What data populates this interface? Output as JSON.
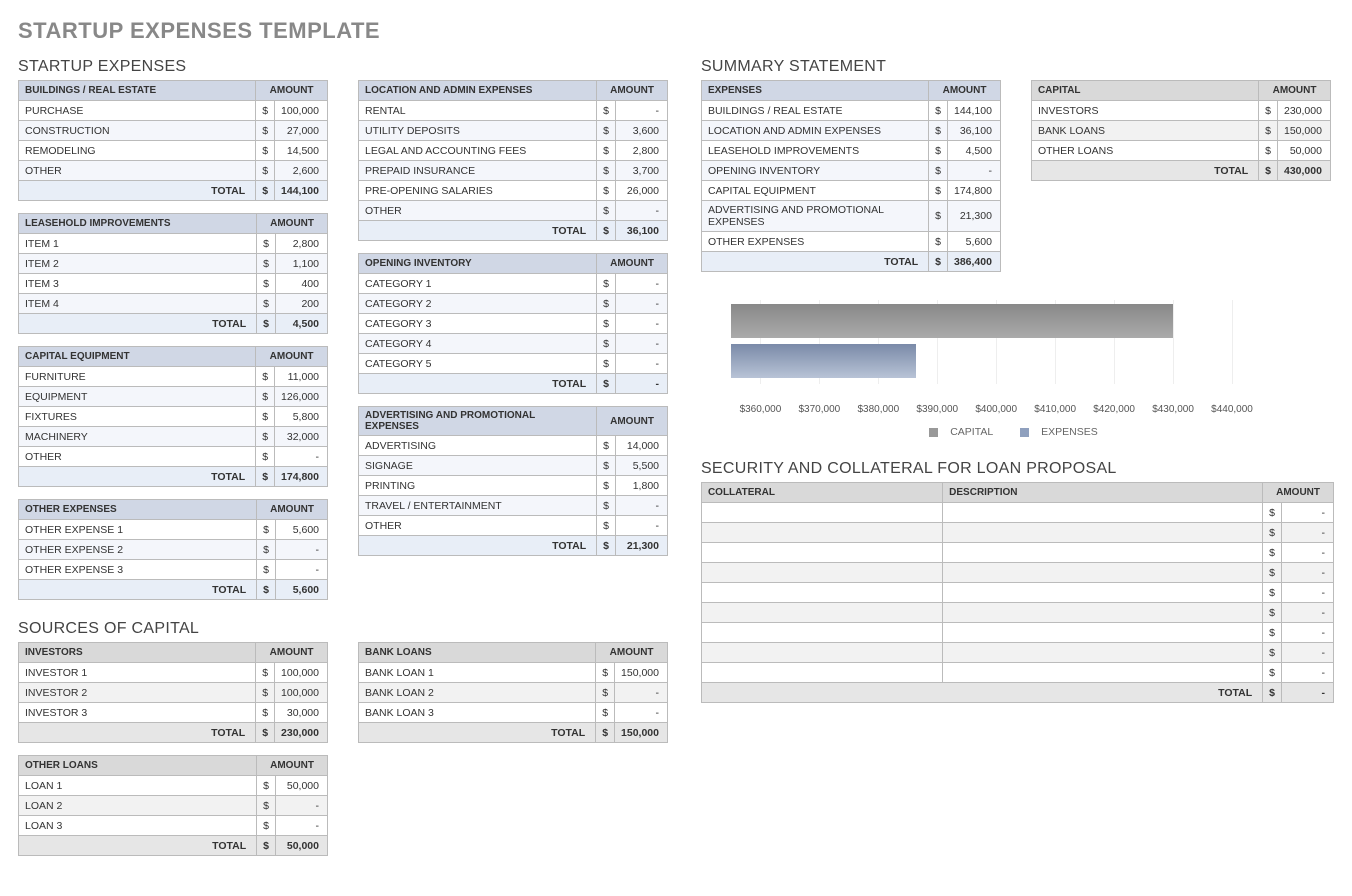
{
  "page_title": "STARTUP EXPENSES TEMPLATE",
  "sections": {
    "startup_expenses": "STARTUP EXPENSES",
    "sources_of_capital": "SOURCES OF CAPITAL",
    "summary_statement": "SUMMARY STATEMENT",
    "security_collateral": "SECURITY AND COLLATERAL FOR LOAN PROPOSAL"
  },
  "labels": {
    "amount": "AMOUNT",
    "total": "TOTAL",
    "description": "DESCRIPTION",
    "collateral": "COLLATERAL"
  },
  "tables": {
    "buildings": {
      "title": "BUILDINGS / REAL ESTATE",
      "rows": [
        {
          "label": "PURCHASE",
          "value": "100,000"
        },
        {
          "label": "CONSTRUCTION",
          "value": "27,000"
        },
        {
          "label": "REMODELING",
          "value": "14,500"
        },
        {
          "label": "OTHER",
          "value": "2,600"
        }
      ],
      "total": "144,100"
    },
    "leasehold": {
      "title": "LEASEHOLD IMPROVEMENTS",
      "rows": [
        {
          "label": "ITEM 1",
          "value": "2,800"
        },
        {
          "label": "ITEM 2",
          "value": "1,100"
        },
        {
          "label": "ITEM 3",
          "value": "400"
        },
        {
          "label": "ITEM 4",
          "value": "200"
        }
      ],
      "total": "4,500"
    },
    "capital_equipment": {
      "title": "CAPITAL EQUIPMENT",
      "rows": [
        {
          "label": "FURNITURE",
          "value": "11,000"
        },
        {
          "label": "EQUIPMENT",
          "value": "126,000"
        },
        {
          "label": "FIXTURES",
          "value": "5,800"
        },
        {
          "label": "MACHINERY",
          "value": "32,000"
        },
        {
          "label": "OTHER",
          "value": "-"
        }
      ],
      "total": "174,800"
    },
    "other_expenses": {
      "title": "OTHER EXPENSES",
      "rows": [
        {
          "label": "OTHER EXPENSE 1",
          "value": "5,600"
        },
        {
          "label": "OTHER EXPENSE 2",
          "value": "-"
        },
        {
          "label": "OTHER EXPENSE 3",
          "value": "-"
        }
      ],
      "total": "5,600"
    },
    "location_admin": {
      "title": "LOCATION AND ADMIN EXPENSES",
      "rows": [
        {
          "label": "RENTAL",
          "value": "-"
        },
        {
          "label": "UTILITY DEPOSITS",
          "value": "3,600"
        },
        {
          "label": "LEGAL AND ACCOUNTING FEES",
          "value": "2,800"
        },
        {
          "label": "PREPAID INSURANCE",
          "value": "3,700"
        },
        {
          "label": "PRE-OPENING SALARIES",
          "value": "26,000"
        },
        {
          "label": "OTHER",
          "value": "-"
        }
      ],
      "total": "36,100"
    },
    "opening_inventory": {
      "title": "OPENING INVENTORY",
      "rows": [
        {
          "label": "CATEGORY 1",
          "value": "-"
        },
        {
          "label": "CATEGORY 2",
          "value": "-"
        },
        {
          "label": "CATEGORY 3",
          "value": "-"
        },
        {
          "label": "CATEGORY 4",
          "value": "-"
        },
        {
          "label": "CATEGORY 5",
          "value": "-"
        }
      ],
      "total": "-"
    },
    "advertising": {
      "title": "ADVERTISING AND PROMOTIONAL EXPENSES",
      "rows": [
        {
          "label": "ADVERTISING",
          "value": "14,000"
        },
        {
          "label": "SIGNAGE",
          "value": "5,500"
        },
        {
          "label": "PRINTING",
          "value": "1,800"
        },
        {
          "label": "TRAVEL / ENTERTAINMENT",
          "value": "-"
        },
        {
          "label": "OTHER",
          "value": "-"
        }
      ],
      "total": "21,300"
    },
    "investors": {
      "title": "INVESTORS",
      "rows": [
        {
          "label": "INVESTOR 1",
          "value": "100,000"
        },
        {
          "label": "INVESTOR 2",
          "value": "100,000"
        },
        {
          "label": "INVESTOR 3",
          "value": "30,000"
        }
      ],
      "total": "230,000"
    },
    "other_loans": {
      "title": "OTHER LOANS",
      "rows": [
        {
          "label": "LOAN 1",
          "value": "50,000"
        },
        {
          "label": "LOAN 2",
          "value": "-"
        },
        {
          "label": "LOAN 3",
          "value": "-"
        }
      ],
      "total": "50,000"
    },
    "bank_loans": {
      "title": "BANK LOANS",
      "rows": [
        {
          "label": "BANK LOAN 1",
          "value": "150,000"
        },
        {
          "label": "BANK LOAN 2",
          "value": "-"
        },
        {
          "label": "BANK LOAN 3",
          "value": "-"
        }
      ],
      "total": "150,000"
    },
    "summary_expenses": {
      "title": "EXPENSES",
      "rows": [
        {
          "label": "BUILDINGS / REAL ESTATE",
          "value": "144,100"
        },
        {
          "label": "LOCATION AND ADMIN EXPENSES",
          "value": "36,100"
        },
        {
          "label": "LEASEHOLD IMPROVEMENTS",
          "value": "4,500"
        },
        {
          "label": "OPENING INVENTORY",
          "value": "-"
        },
        {
          "label": "CAPITAL EQUIPMENT",
          "value": "174,800"
        },
        {
          "label": "ADVERTISING AND PROMOTIONAL EXPENSES",
          "value": "21,300"
        },
        {
          "label": "OTHER EXPENSES",
          "value": "5,600"
        }
      ],
      "total": "386,400"
    },
    "summary_capital": {
      "title": "CAPITAL",
      "rows": [
        {
          "label": "INVESTORS",
          "value": "230,000"
        },
        {
          "label": "BANK LOANS",
          "value": "150,000"
        },
        {
          "label": "OTHER LOANS",
          "value": "50,000"
        }
      ],
      "total": "430,000"
    },
    "collateral": {
      "rows": [
        {
          "c": "",
          "d": "",
          "v": "-"
        },
        {
          "c": "",
          "d": "",
          "v": "-"
        },
        {
          "c": "",
          "d": "",
          "v": "-"
        },
        {
          "c": "",
          "d": "",
          "v": "-"
        },
        {
          "c": "",
          "d": "",
          "v": "-"
        },
        {
          "c": "",
          "d": "",
          "v": "-"
        },
        {
          "c": "",
          "d": "",
          "v": "-"
        },
        {
          "c": "",
          "d": "",
          "v": "-"
        },
        {
          "c": "",
          "d": "",
          "v": "-"
        }
      ],
      "total": "-"
    }
  },
  "chart_data": {
    "type": "bar",
    "orientation": "horizontal",
    "categories": [
      "CAPITAL",
      "EXPENSES"
    ],
    "values": [
      430000,
      386400
    ],
    "xlim": [
      355000,
      450000
    ],
    "x_ticks": [
      "$360,000",
      "$370,000",
      "$380,000",
      "$390,000",
      "$400,000",
      "$410,000",
      "$420,000",
      "$430,000",
      "$440,000"
    ],
    "legend": [
      "CAPITAL",
      "EXPENSES"
    ]
  }
}
